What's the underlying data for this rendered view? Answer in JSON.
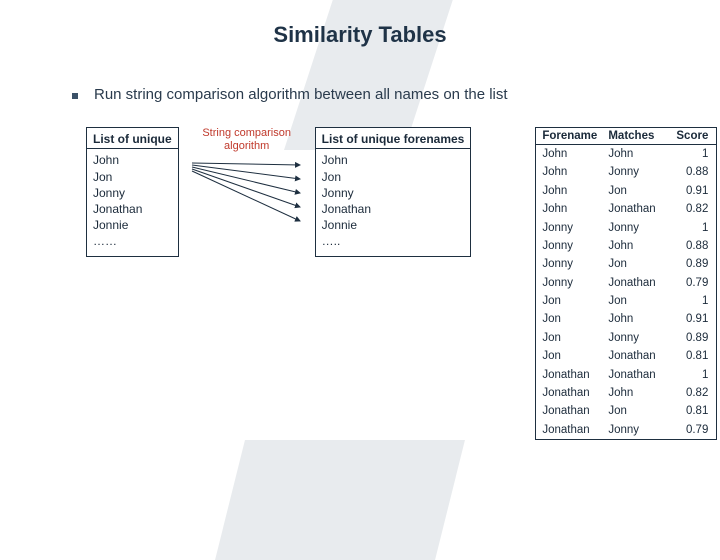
{
  "title": "Similarity Tables",
  "bullet": "Run string comparison algorithm between all names on the list",
  "left_box": {
    "header": "List of unique",
    "items": [
      "John",
      "Jon",
      "Jonny",
      "Jonathan",
      "Jonnie",
      "……"
    ]
  },
  "mid_label_line1": "String comparison",
  "mid_label_line2": "algorithm",
  "right_box": {
    "header": "List of unique forenames",
    "items": [
      "John",
      "Jon",
      "Jonny",
      "Jonathan",
      "Jonnie",
      "….."
    ]
  },
  "score_table": {
    "headers": [
      "Forename",
      "Matches",
      "Score"
    ],
    "rows": [
      [
        "John",
        "John",
        "1"
      ],
      [
        "John",
        "Jonny",
        "0.88"
      ],
      [
        "John",
        "Jon",
        "0.91"
      ],
      [
        "John",
        "Jonathan",
        "0.82"
      ],
      [
        "Jonny",
        "Jonny",
        "1"
      ],
      [
        "Jonny",
        "John",
        "0.88"
      ],
      [
        "Jonny",
        "Jon",
        "0.89"
      ],
      [
        "Jonny",
        "Jonathan",
        "0.79"
      ],
      [
        "Jon",
        "Jon",
        "1"
      ],
      [
        "Jon",
        "John",
        "0.91"
      ],
      [
        "Jon",
        "Jonny",
        "0.89"
      ],
      [
        "Jon",
        "Jonathan",
        "0.81"
      ],
      [
        "Jonathan",
        "Jonathan",
        "1"
      ],
      [
        "Jonathan",
        "John",
        "0.82"
      ],
      [
        "Jonathan",
        "Jon",
        "0.81"
      ],
      [
        "Jonathan",
        "Jonny",
        "0.79"
      ]
    ]
  }
}
